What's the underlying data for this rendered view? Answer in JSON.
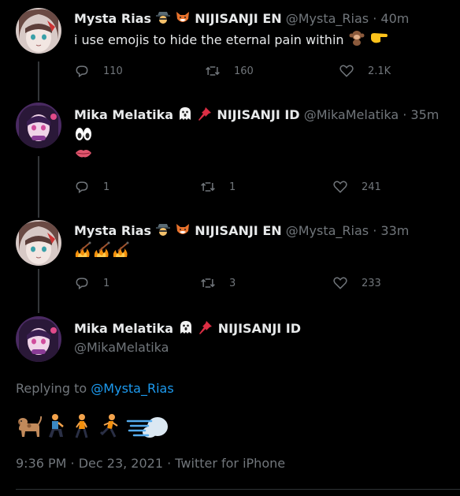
{
  "tweets": [
    {
      "name": "Mysta Rias",
      "org": "NIJISANJI EN",
      "handle": "@Mysta_Rias",
      "time": "40m",
      "text": "i use emojis to hide the eternal pain within",
      "replies": "110",
      "retweets": "160",
      "likes": "2.1K"
    },
    {
      "name": "Mika Melatika",
      "org": "NIJISANJI ID",
      "handle": "@MikaMelatika",
      "time": "35m",
      "text": "",
      "replies": "1",
      "retweets": "1",
      "likes": "241"
    },
    {
      "name": "Mysta Rias",
      "org": "NIJISANJI EN",
      "handle": "@Mysta_Rias",
      "time": "33m",
      "text": "",
      "replies": "1",
      "retweets": "3",
      "likes": "233"
    }
  ],
  "main": {
    "name": "Mika Melatika",
    "org": "NIJISANJI ID",
    "handle": "@MikaMelatika",
    "replying_prefix": "Replying to ",
    "replying_handle": "@Mysta_Rias",
    "timestamp": "9:36 PM · Dec 23, 2021 · Twitter for iPhone"
  },
  "icons": {
    "reply": "reply-icon",
    "retweet": "retweet-icon",
    "like": "heart-icon"
  },
  "colors": {
    "background": "#000000",
    "text": "#e7e9ea",
    "muted": "#71767b",
    "link": "#1d9bf0"
  }
}
